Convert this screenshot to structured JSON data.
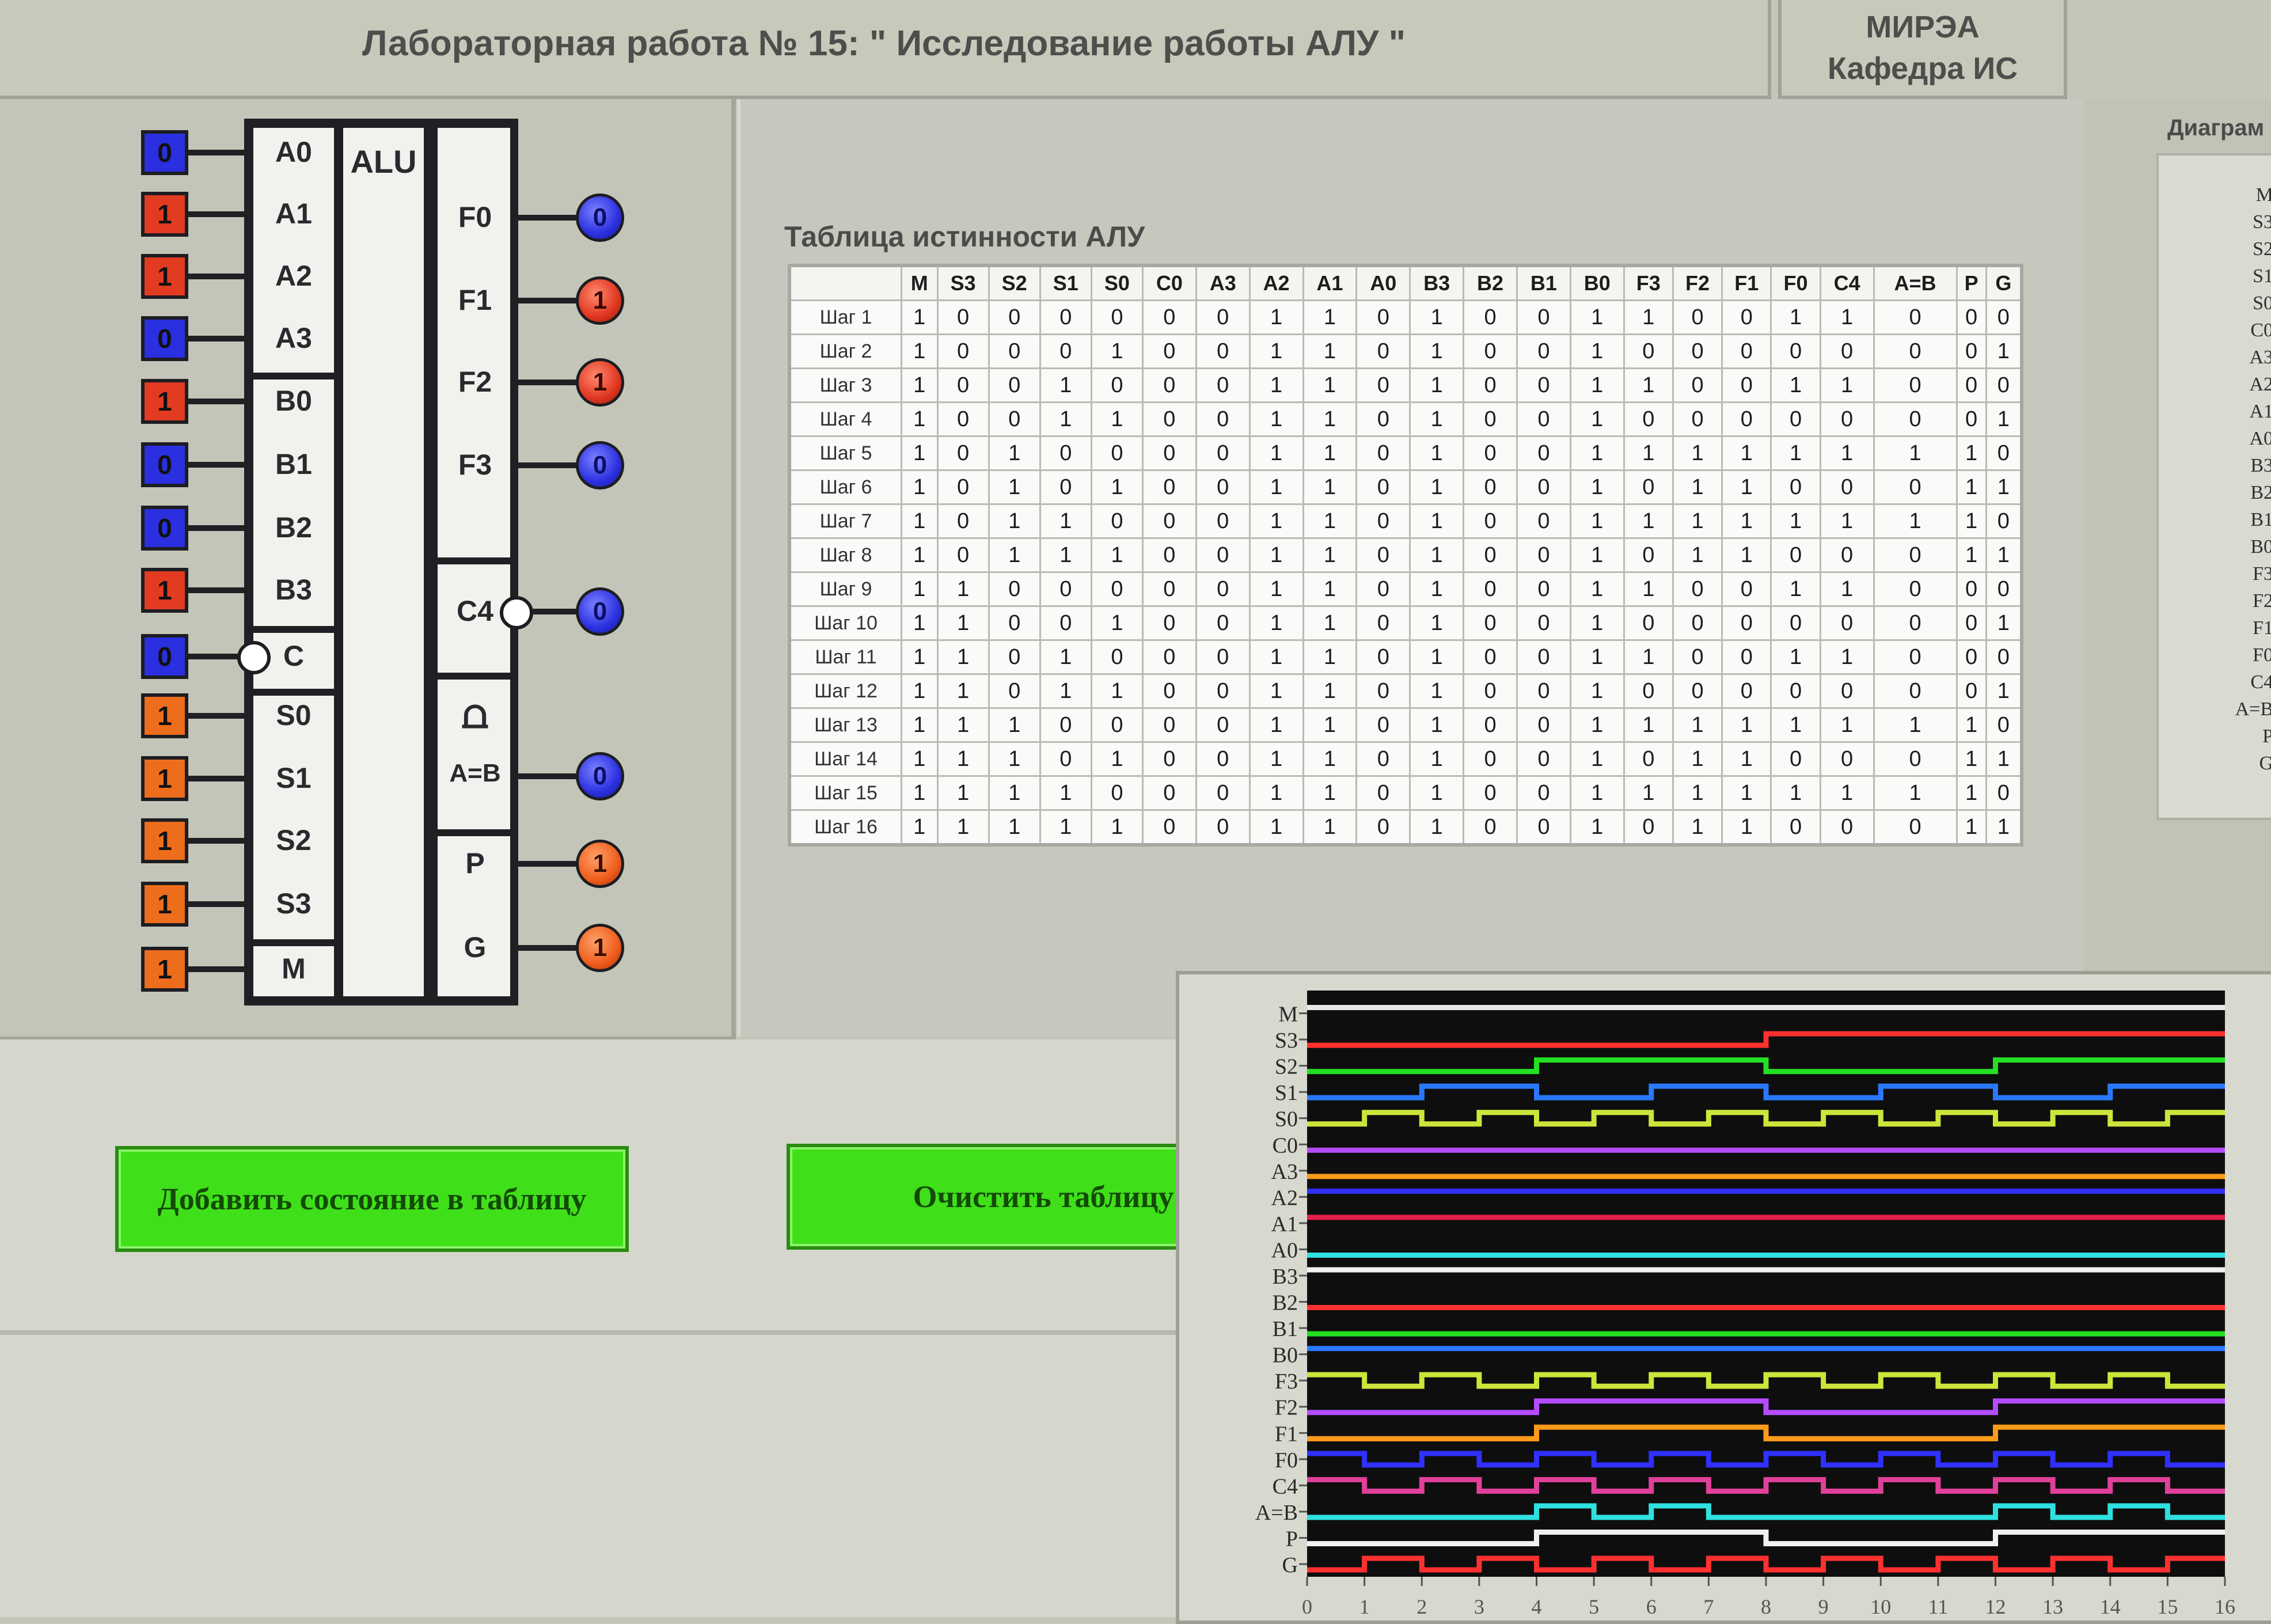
{
  "header": {
    "title": "Лабораторная работа № 15: \" Исследование работы АЛУ \"",
    "org_line1": "МИРЭА",
    "org_line2": "Кафедра ИС"
  },
  "alu": {
    "block_label": "ALU",
    "inputs": [
      {
        "label": "A0",
        "value": "0",
        "color": "#2a2fe0"
      },
      {
        "label": "A1",
        "value": "1",
        "color": "#e23b22"
      },
      {
        "label": "A2",
        "value": "1",
        "color": "#e23b22"
      },
      {
        "label": "A3",
        "value": "0",
        "color": "#2a2fe0"
      },
      {
        "label": "B0",
        "value": "1",
        "color": "#e23b22"
      },
      {
        "label": "B1",
        "value": "0",
        "color": "#2a2fe0"
      },
      {
        "label": "B2",
        "value": "0",
        "color": "#2a2fe0"
      },
      {
        "label": "B3",
        "value": "1",
        "color": "#e23b22"
      },
      {
        "label": "C",
        "value": "0",
        "color": "#2a2fe0"
      },
      {
        "label": "S0",
        "value": "1",
        "color": "#ee6d1d"
      },
      {
        "label": "S1",
        "value": "1",
        "color": "#ee6d1d"
      },
      {
        "label": "S2",
        "value": "1",
        "color": "#ee6d1d"
      },
      {
        "label": "S3",
        "value": "1",
        "color": "#ee6d1d"
      },
      {
        "label": "M",
        "value": "1",
        "color": "#ee6d1d"
      }
    ],
    "outputs": [
      {
        "label": "F0",
        "value": "0"
      },
      {
        "label": "F1",
        "value": "1"
      },
      {
        "label": "F2",
        "value": "1"
      },
      {
        "label": "F3",
        "value": "0"
      },
      {
        "label": "C4",
        "value": "0"
      },
      {
        "label": "A=B",
        "value": "0"
      },
      {
        "label": "P",
        "value": "1"
      },
      {
        "label": "G",
        "value": "1"
      }
    ],
    "comparator_symbol": "⩍"
  },
  "truth_table": {
    "title": "Таблица истинности АЛУ",
    "columns": [
      "",
      "M",
      "S3",
      "S2",
      "S1",
      "S0",
      "C0",
      "A3",
      "A2",
      "A1",
      "A0",
      "B3",
      "B2",
      "B1",
      "B0",
      "F3",
      "F2",
      "F1",
      "F0",
      "C4",
      "A=B",
      "P",
      "G"
    ],
    "rows": [
      [
        "Шаг 1",
        "1",
        "0",
        "0",
        "0",
        "0",
        "0",
        "0",
        "1",
        "1",
        "0",
        "1",
        "0",
        "0",
        "1",
        "1",
        "0",
        "0",
        "1",
        "1",
        "0",
        "0",
        "0"
      ],
      [
        "Шаг 2",
        "1",
        "0",
        "0",
        "0",
        "1",
        "0",
        "0",
        "1",
        "1",
        "0",
        "1",
        "0",
        "0",
        "1",
        "0",
        "0",
        "0",
        "0",
        "0",
        "0",
        "0",
        "1"
      ],
      [
        "Шаг 3",
        "1",
        "0",
        "0",
        "1",
        "0",
        "0",
        "0",
        "1",
        "1",
        "0",
        "1",
        "0",
        "0",
        "1",
        "1",
        "0",
        "0",
        "1",
        "1",
        "0",
        "0",
        "0"
      ],
      [
        "Шаг 4",
        "1",
        "0",
        "0",
        "1",
        "1",
        "0",
        "0",
        "1",
        "1",
        "0",
        "1",
        "0",
        "0",
        "1",
        "0",
        "0",
        "0",
        "0",
        "0",
        "0",
        "0",
        "1"
      ],
      [
        "Шаг 5",
        "1",
        "0",
        "1",
        "0",
        "0",
        "0",
        "0",
        "1",
        "1",
        "0",
        "1",
        "0",
        "0",
        "1",
        "1",
        "1",
        "1",
        "1",
        "1",
        "1",
        "1",
        "0"
      ],
      [
        "Шаг 6",
        "1",
        "0",
        "1",
        "0",
        "1",
        "0",
        "0",
        "1",
        "1",
        "0",
        "1",
        "0",
        "0",
        "1",
        "0",
        "1",
        "1",
        "0",
        "0",
        "0",
        "1",
        "1"
      ],
      [
        "Шаг 7",
        "1",
        "0",
        "1",
        "1",
        "0",
        "0",
        "0",
        "1",
        "1",
        "0",
        "1",
        "0",
        "0",
        "1",
        "1",
        "1",
        "1",
        "1",
        "1",
        "1",
        "1",
        "0"
      ],
      [
        "Шаг 8",
        "1",
        "0",
        "1",
        "1",
        "1",
        "0",
        "0",
        "1",
        "1",
        "0",
        "1",
        "0",
        "0",
        "1",
        "0",
        "1",
        "1",
        "0",
        "0",
        "0",
        "1",
        "1"
      ],
      [
        "Шаг 9",
        "1",
        "1",
        "0",
        "0",
        "0",
        "0",
        "0",
        "1",
        "1",
        "0",
        "1",
        "0",
        "0",
        "1",
        "1",
        "0",
        "0",
        "1",
        "1",
        "0",
        "0",
        "0"
      ],
      [
        "Шаг 10",
        "1",
        "1",
        "0",
        "0",
        "1",
        "0",
        "0",
        "1",
        "1",
        "0",
        "1",
        "0",
        "0",
        "1",
        "0",
        "0",
        "0",
        "0",
        "0",
        "0",
        "0",
        "1"
      ],
      [
        "Шаг 11",
        "1",
        "1",
        "0",
        "1",
        "0",
        "0",
        "0",
        "1",
        "1",
        "0",
        "1",
        "0",
        "0",
        "1",
        "1",
        "0",
        "0",
        "1",
        "1",
        "0",
        "0",
        "0"
      ],
      [
        "Шаг 12",
        "1",
        "1",
        "0",
        "1",
        "1",
        "0",
        "0",
        "1",
        "1",
        "0",
        "1",
        "0",
        "0",
        "1",
        "0",
        "0",
        "0",
        "0",
        "0",
        "0",
        "0",
        "1"
      ],
      [
        "Шаг 13",
        "1",
        "1",
        "1",
        "0",
        "0",
        "0",
        "0",
        "1",
        "1",
        "0",
        "1",
        "0",
        "0",
        "1",
        "1",
        "1",
        "1",
        "1",
        "1",
        "1",
        "1",
        "0"
      ],
      [
        "Шаг 14",
        "1",
        "1",
        "1",
        "0",
        "1",
        "0",
        "0",
        "1",
        "1",
        "0",
        "1",
        "0",
        "0",
        "1",
        "0",
        "1",
        "1",
        "0",
        "0",
        "0",
        "1",
        "1"
      ],
      [
        "Шаг 15",
        "1",
        "1",
        "1",
        "1",
        "0",
        "0",
        "0",
        "1",
        "1",
        "0",
        "1",
        "0",
        "0",
        "1",
        "1",
        "1",
        "1",
        "1",
        "1",
        "1",
        "1",
        "0"
      ],
      [
        "Шаг 16",
        "1",
        "1",
        "1",
        "1",
        "1",
        "0",
        "0",
        "1",
        "1",
        "0",
        "1",
        "0",
        "0",
        "1",
        "0",
        "1",
        "1",
        "0",
        "0",
        "0",
        "1",
        "1"
      ]
    ]
  },
  "buttons": {
    "add_state": "Добавить состояние в таблицу",
    "clear_table": "Очистить таблицу"
  },
  "side_panel": {
    "title": "Диаграм",
    "labels": [
      "M",
      "S3",
      "S2",
      "S1",
      "S0",
      "C0",
      "A3",
      "A2",
      "A1",
      "A0",
      "B3",
      "B2",
      "B1",
      "B0",
      "F3",
      "F2",
      "F1",
      "F0",
      "C4",
      "A=B",
      "P",
      "G"
    ]
  },
  "timing_diagram": {
    "signals": [
      "M",
      "S3",
      "S2",
      "S1",
      "S0",
      "C0",
      "A3",
      "A2",
      "A1",
      "A0",
      "B3",
      "B2",
      "B1",
      "B0",
      "F3",
      "F2",
      "F1",
      "F0",
      "C4",
      "A=B",
      "P",
      "G"
    ],
    "signal_colors": [
      "#e8e8e8",
      "#ff3030",
      "#22e022",
      "#2a78ff",
      "#cde53a",
      "#b44cff",
      "#ff9a1a",
      "#3030ff",
      "#e0204a",
      "#2ee0e0",
      "#f0f0f0",
      "#ff3030",
      "#22e022",
      "#2a78ff",
      "#cde53a",
      "#b44cff",
      "#ff9a1a",
      "#3030ff",
      "#e0409a",
      "#2ee0e0",
      "#f0f0f0",
      "#ff3030"
    ],
    "x_ticks": [
      "0",
      "1",
      "2",
      "3",
      "4",
      "5",
      "6",
      "7",
      "8",
      "9",
      "10",
      "11",
      "12",
      "13",
      "14",
      "15",
      "16"
    ],
    "background": "#0e0e0e"
  }
}
